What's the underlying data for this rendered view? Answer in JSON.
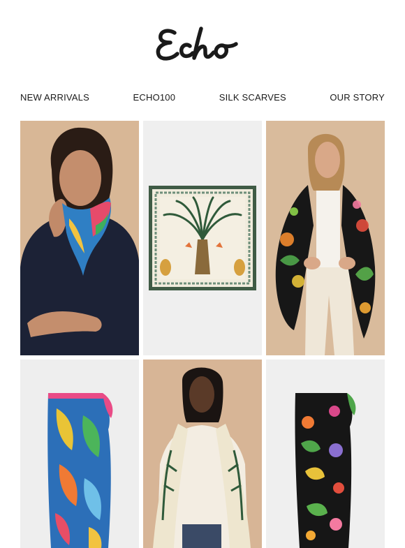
{
  "brand": {
    "name": "Echo"
  },
  "nav": {
    "items": [
      {
        "label": "NEW ARRIVALS"
      },
      {
        "label": "ECHO100"
      },
      {
        "label": "SILK SCARVES"
      },
      {
        "label": "OUR STORY"
      }
    ]
  },
  "products": [
    {
      "image": "model-wearing-tropical-neckerchief",
      "background": "#d8b796"
    },
    {
      "image": "palm-paradise-silk-square-scarf",
      "background": "#efefef"
    },
    {
      "image": "model-wearing-black-floral-wrap",
      "background": "#d9bb9c"
    },
    {
      "image": "tropical-leaf-sarong-scarf",
      "background": "#eeeeee"
    },
    {
      "image": "model-wearing-palm-print-wrap",
      "background": "#d7b596"
    },
    {
      "image": "black-floral-sarong-scarf",
      "background": "#efefef"
    }
  ]
}
